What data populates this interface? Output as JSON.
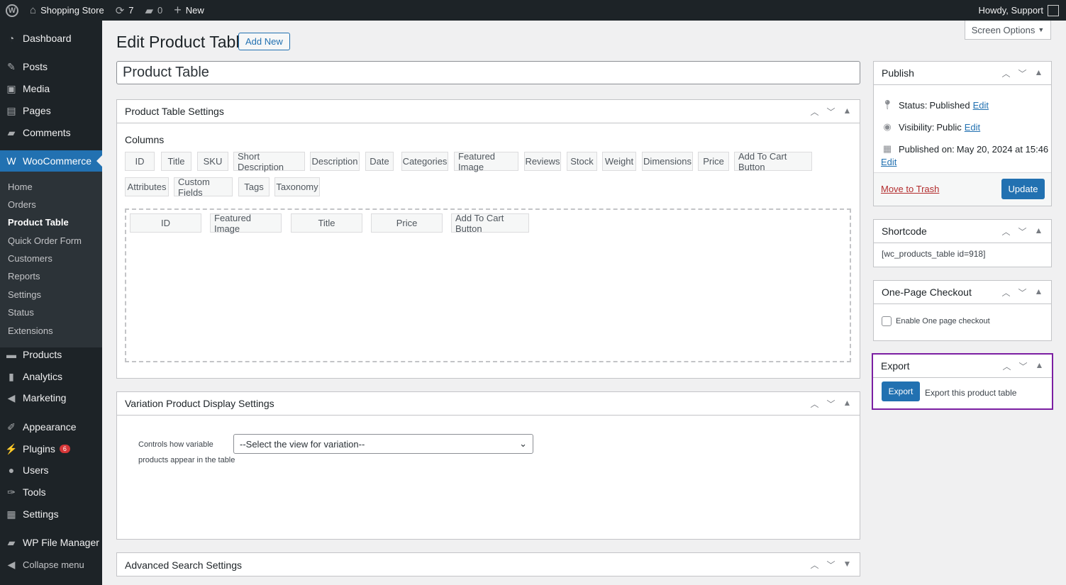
{
  "adminbar": {
    "site": "Shopping Store",
    "updates": "7",
    "comments": "0",
    "new": "New",
    "howdy": "Howdy, Support"
  },
  "sidebar": {
    "items": [
      {
        "label": "Dashboard",
        "icon": "dashboard-icon"
      },
      {
        "label": "Posts",
        "icon": "pin-icon"
      },
      {
        "label": "Media",
        "icon": "media-icon"
      },
      {
        "label": "Pages",
        "icon": "pages-icon"
      },
      {
        "label": "Comments",
        "icon": "comment-icon"
      },
      {
        "label": "WooCommerce",
        "icon": "woo-icon"
      },
      {
        "label": "Products",
        "icon": "archive-icon"
      },
      {
        "label": "Analytics",
        "icon": "chart-icon"
      },
      {
        "label": "Marketing",
        "icon": "megaphone-icon"
      },
      {
        "label": "Appearance",
        "icon": "brush-icon"
      },
      {
        "label": "Plugins",
        "icon": "plugin-icon",
        "badge": "6"
      },
      {
        "label": "Users",
        "icon": "user-icon"
      },
      {
        "label": "Tools",
        "icon": "wrench-icon"
      },
      {
        "label": "Settings",
        "icon": "settings-icon"
      },
      {
        "label": "WP File Manager",
        "icon": "folder-icon"
      },
      {
        "label": "Collapse menu",
        "icon": "collapse-icon"
      }
    ],
    "submenu": [
      "Home",
      "Orders",
      "Product Table",
      "Quick Order Form",
      "Customers",
      "Reports",
      "Settings",
      "Status",
      "Extensions"
    ]
  },
  "page": {
    "title": "Edit Product Table",
    "add_new": "Add New",
    "screen_options": "Screen Options",
    "post_title": "Product Table"
  },
  "settings": {
    "title": "Product Table Settings",
    "columns_label": "Columns",
    "available": [
      "ID",
      "Title",
      "SKU",
      "Short Description",
      "Description",
      "Date",
      "Categories",
      "Featured Image",
      "Reviews",
      "Stock",
      "Weight",
      "Dimensions",
      "Price",
      "Add To Cart Button",
      "Attributes",
      "Custom Fields",
      "Tags",
      "Taxonomy"
    ],
    "selected": [
      "ID",
      "Featured Image",
      "Title",
      "Price",
      "Add To Cart Button"
    ]
  },
  "variation": {
    "title": "Variation Product Display Settings",
    "label_1": "Controls how variable",
    "label_2": "products appear in the table",
    "select_value": "--Select the view for variation--"
  },
  "advanced": {
    "title": "Advanced Search Settings"
  },
  "publish": {
    "title": "Publish",
    "status_label": "Status:",
    "status": "Published",
    "visibility_label": "Visibility:",
    "visibility": "Public",
    "published_label": "Published on:",
    "published": "May 20, 2024 at 15:46",
    "edit": "Edit",
    "trash": "Move to Trash",
    "update": "Update"
  },
  "shortcode": {
    "title": "Shortcode",
    "value": "[wc_products_table id=918]"
  },
  "onepage": {
    "title": "One-Page Checkout",
    "checkbox": "Enable One page checkout"
  },
  "export": {
    "title": "Export",
    "button": "Export",
    "desc": "Export this product table",
    "highlight": "#7b1fa2"
  }
}
